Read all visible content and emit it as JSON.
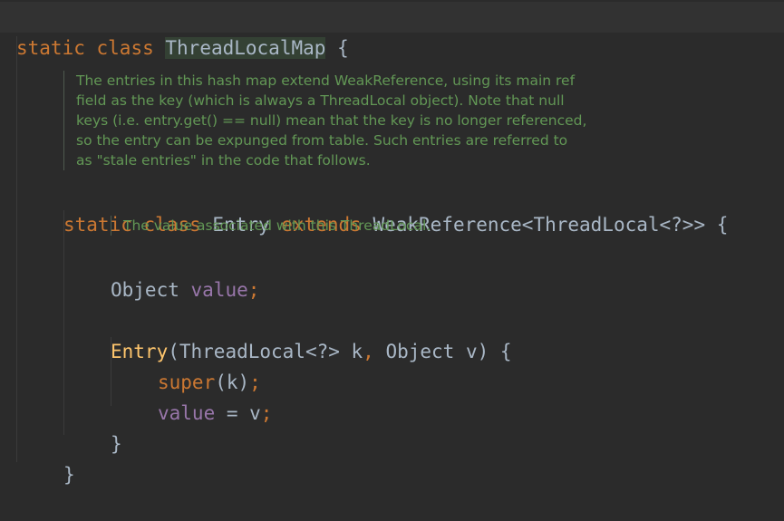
{
  "editor": {
    "class_header": {
      "keyword1": "static",
      "keyword2": "class",
      "class_name": "ThreadLocalMap",
      "brace": "{"
    },
    "doc_comment_1": {
      "lines": [
        "The entries in this hash map extend WeakReference, using its main ref",
        "field as the key (which is always a ThreadLocal object). Note that null",
        "keys (i.e. entry.get() == null) mean that the key is no longer referenced,",
        "so the entry can be expunged from table. Such entries are referred to",
        "as \"stale entries\" in the code that follows."
      ]
    },
    "entry_header": {
      "keyword1": "static",
      "keyword2": "class",
      "class_name": "Entry",
      "extends": "extends",
      "super_type": "WeakReference<ThreadLocal<?>>",
      "brace": "{"
    },
    "doc_comment_2": {
      "text": "The value associated with this ThreadLocal."
    },
    "field_decl": {
      "type": "Object",
      "name": "value",
      "semicolon": ";"
    },
    "constructor": {
      "name": "Entry",
      "open_paren": "(",
      "param1": "ThreadLocal<?> k",
      "comma": ",",
      "param2": " Object v",
      "close": ") {"
    },
    "super_call": {
      "keyword": "super",
      "args": "(k)",
      "semicolon": ";"
    },
    "assign": {
      "field": "value",
      "op": " = v",
      "semicolon": ";"
    },
    "ctor_close": "}",
    "class_close": "}"
  },
  "colors": {
    "background": "#2b2b2b",
    "keyword": "#cc7832",
    "default_text": "#a9b7c6",
    "method": "#ffc66d",
    "field": "#9876aa",
    "doc_comment": "#629755"
  }
}
